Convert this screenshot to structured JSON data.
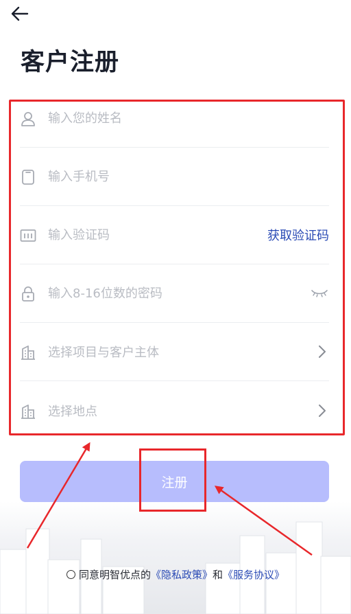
{
  "title": "客户注册",
  "form": {
    "name_placeholder": "输入您的姓名",
    "phone_placeholder": "输入手机号",
    "code_placeholder": "输入验证码",
    "get_code_label": "获取验证码",
    "password_placeholder": "输入8-16位数的密码",
    "project_placeholder": "选择项目与客户主体",
    "location_placeholder": "选择地点"
  },
  "submit_label": "注册",
  "agreement": {
    "prefix": "同意明智优点的",
    "privacy_link": "《隐私政策》",
    "conjunction": "和",
    "service_link": "《服务协议》"
  },
  "icons": {
    "back": "arrow-left-icon",
    "name": "user-icon",
    "phone": "phone-icon",
    "code": "barcode-icon",
    "password": "lock-icon",
    "eye": "eye-closed-icon",
    "building": "building-icon",
    "chevron": "chevron-right-icon"
  },
  "colors": {
    "accent": "#2b4bb5",
    "button": "#b7bdfd",
    "annotation": "#e8272b"
  }
}
